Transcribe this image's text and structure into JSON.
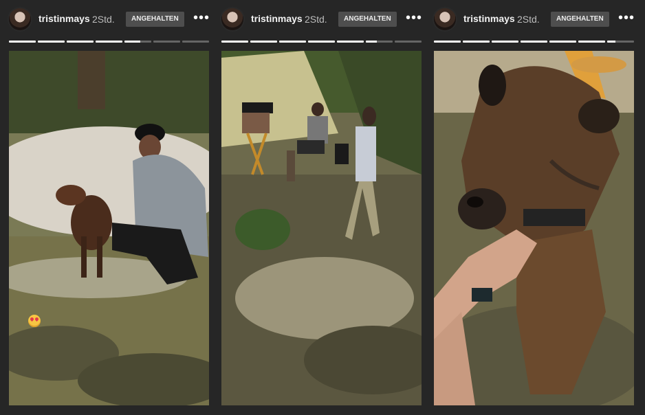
{
  "stories": [
    {
      "username": "tristinmays",
      "time": "2Std.",
      "status": "ANGEHALTEN",
      "more": "•••",
      "progress": [
        1,
        1,
        1,
        1,
        0.6,
        0,
        0
      ],
      "photo_alt": "Man in cap crouching with brown dog"
    },
    {
      "username": "tristinmays",
      "time": "2Std.",
      "status": "ANGEHALTEN",
      "more": "•••",
      "progress": [
        1,
        1,
        1,
        1,
        1,
        0.4,
        0
      ],
      "photo_alt": "Two men on set in grassy hillside"
    },
    {
      "username": "tristinmays",
      "time": "2Std.",
      "status": "ANGEHALTEN",
      "more": "•••",
      "progress": [
        1,
        1,
        1,
        1,
        1,
        1,
        0.3
      ],
      "photo_alt": "Hand petting a brown dog"
    }
  ],
  "colors": {
    "background": "#262626",
    "progress_fill": "#ffffff",
    "progress_track": "#666666",
    "badge": "#4e4e4e"
  }
}
